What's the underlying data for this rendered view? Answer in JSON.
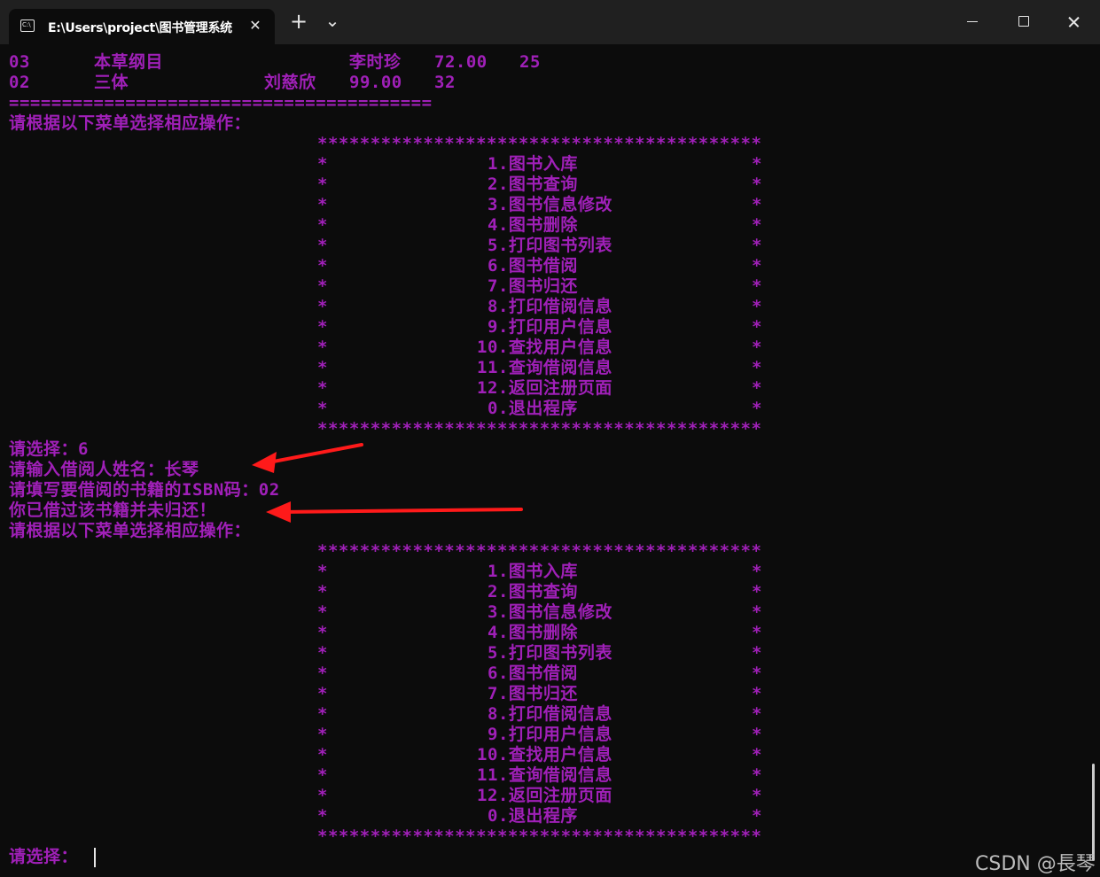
{
  "window": {
    "tab_title": "E:\\Users\\project\\图书管理系统",
    "tab_close": "✕",
    "new_tab": "+",
    "tab_dropdown": "⌄"
  },
  "colors": {
    "terminal_bg": "#0c0c0c",
    "text": "#a020b8",
    "arrow": "#ff1a1a"
  },
  "books": [
    {
      "id": "03",
      "title": "本草纲目",
      "author": "李时珍",
      "price": "72.00",
      "stock": "25"
    },
    {
      "id": "02",
      "title": "三体",
      "author": "刘慈欣",
      "price": "99.00",
      "stock": "32"
    }
  ],
  "separator": "========================================",
  "menu_prompt": "请根据以下菜单选择相应操作：",
  "menu_border": "******************************************",
  "menu_items": [
    "1.图书入库",
    "2.图书查询",
    "3.图书信息修改",
    "4.图书删除",
    "5.打印图书列表",
    "6.图书借阅",
    "7.图书归还",
    "8.打印借阅信息",
    "9.打印用户信息",
    "10.查找用户信息",
    "11.查询借阅信息",
    "12.返回注册页面",
    "0.退出程序"
  ],
  "star": "*",
  "session": {
    "choice_line": "请选择：6",
    "name_line": "请输入借阅人姓名：长琴",
    "isbn_line": "请填写要借阅的书籍的ISBN码：02",
    "error_line": "你已借过该书籍并未归还！"
  },
  "final_prompt": "请选择：",
  "watermark": "CSDN @長琴"
}
